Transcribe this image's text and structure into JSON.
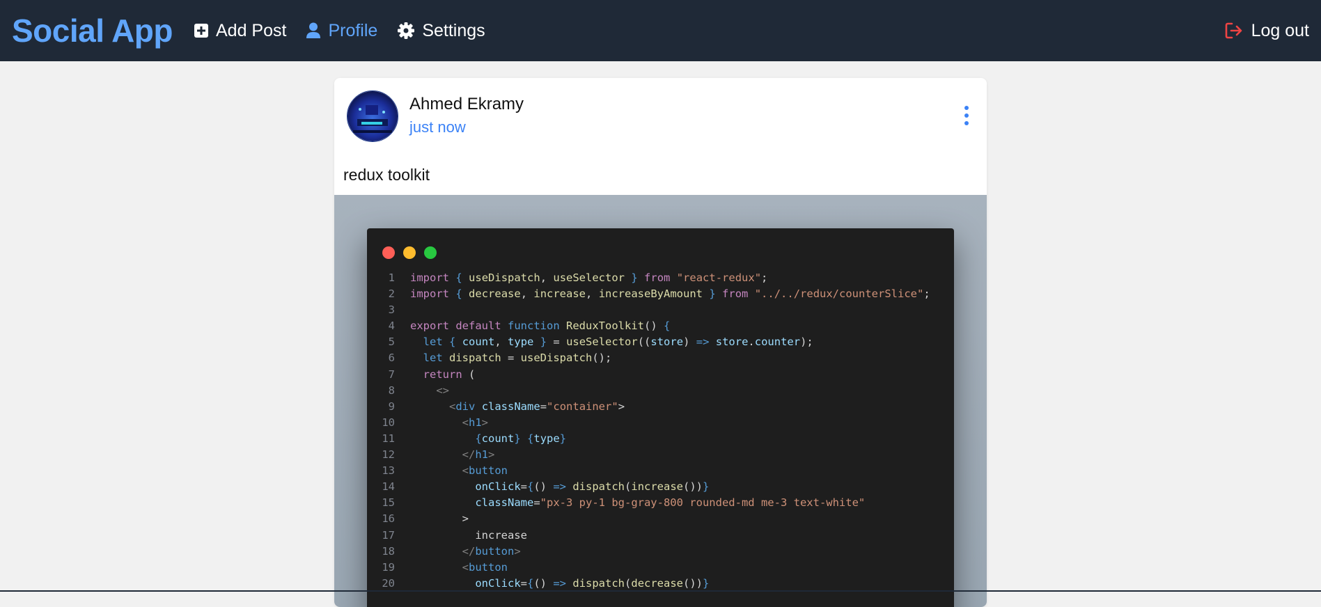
{
  "navbar": {
    "brand": "Social App",
    "links": [
      {
        "label": "Add Post",
        "icon": "plus-square-icon",
        "active": false
      },
      {
        "label": "Profile",
        "icon": "user-icon",
        "active": true
      },
      {
        "label": "Settings",
        "icon": "gear-icon",
        "active": false
      }
    ],
    "logout_label": "Log out",
    "colors": {
      "background": "#1f2937",
      "accent": "#60a5fa",
      "logout_icon": "#ef4444"
    }
  },
  "post": {
    "author": "Ahmed Ekramy",
    "time": "just now",
    "text": "redux toolkit",
    "menu_icon": "vertical-dots-icon",
    "code_image": {
      "lines": [
        "import { useDispatch, useSelector } from \"react-redux\";",
        "import { decrease, increase, increaseByAmount } from \"../../redux/counterSlice\";",
        "",
        "export default function ReduxToolkit() {",
        "  let { count, type } = useSelector((store) => store.counter);",
        "  let dispatch = useDispatch();",
        "  return (",
        "    <>",
        "      <div className=\"container\">",
        "        <h1>",
        "          {count} {type}",
        "        </h1>",
        "        <button",
        "          onClick={() => dispatch(increase())}",
        "          className=\"px-3 py-1 bg-gray-800 rounded-md me-3 text-white\"",
        "        >",
        "          increase",
        "        </button>",
        "        <button",
        "          onClick={() => dispatch(decrease())}"
      ]
    }
  }
}
